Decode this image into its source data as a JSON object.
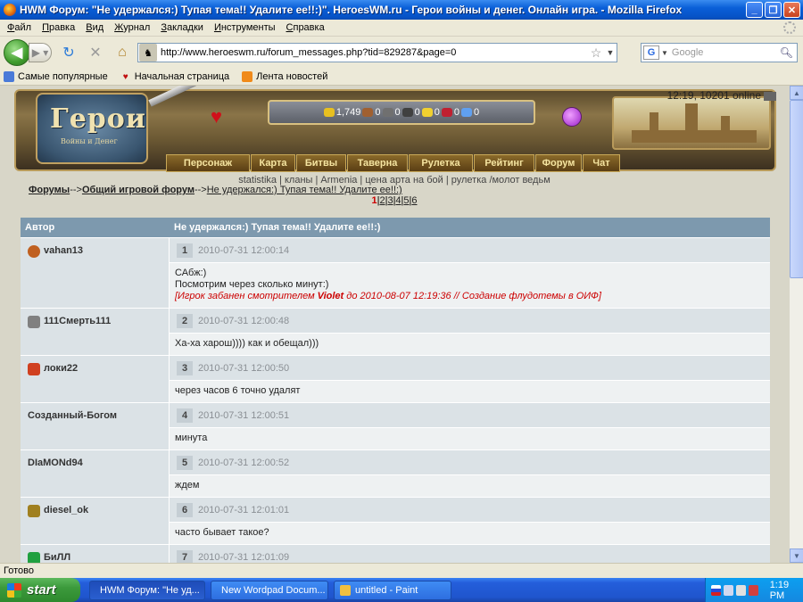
{
  "window": {
    "title": "HWM Форум: \"Не удержался:) Тупая тема!! Удалите ее!!:)\". HeroesWM.ru - Герои войны и денег. Онлайн игра. - Mozilla Firefox",
    "buttons": [
      "_",
      "❐",
      "✕"
    ]
  },
  "menubar": [
    "Файл",
    "Правка",
    "Вид",
    "Журнал",
    "Закладки",
    "Инструменты",
    "Справка"
  ],
  "nav": {
    "url": "http://www.heroeswm.ru/forum_messages.php?tid=829287&page=0",
    "search_placeholder": "Google"
  },
  "bookmarks": [
    "Самые популярные",
    "Начальная страница",
    "Лента новостей"
  ],
  "game": {
    "online": "12:19, 10201 online",
    "logo_big": "Герои",
    "logo_small": "Войны и Денег",
    "resources": [
      "1,749",
      "0",
      "0",
      "0",
      "0",
      "0",
      "0"
    ],
    "menu": [
      "Персонаж",
      "Карта",
      "Битвы",
      "Таверна",
      "Рулетка",
      "Рейтинг",
      "Форум",
      "Чат"
    ],
    "sublinks": "statistika | кланы | Armenia | цена арта на бой | рулетка /молот ведьм"
  },
  "breadcrumb": {
    "forums": "Форумы",
    "sep1": "-->",
    "general": "Общий игровой форум",
    "sep2": "-->",
    "topic": "Не удержался:) Тупая тема!! Удалите ее!!:)"
  },
  "pages": {
    "current": "1",
    "others": [
      "2",
      "3",
      "4",
      "5",
      "6"
    ]
  },
  "table": {
    "col_author": "Автор",
    "col_topic": "Не удержался:) Тупая тема!! Удалите ее!!:)",
    "posts": [
      {
        "author": "vahan13",
        "num": "1",
        "date": "2010-07-31 12:00:14",
        "lines": [
          "САбж:)",
          "Посмотрим через сколько минут:)"
        ],
        "ban": {
          "pre": "[Игрок забанен смотрителем ",
          "name": "Violet",
          "post": " до 2010-08-07 12:19:36 // Создание флудотемы в ОИФ]"
        }
      },
      {
        "author": "111Смерть111",
        "num": "2",
        "date": "2010-07-31 12:00:48",
        "lines": [
          "Ха-ха харош)))) как и обещал)))"
        ]
      },
      {
        "author": "локи22",
        "num": "3",
        "date": "2010-07-31 12:00:50",
        "lines": [
          "через часов 6 точно удалят"
        ]
      },
      {
        "author": "Созданный-Богом",
        "num": "4",
        "date": "2010-07-31 12:00:51",
        "lines": [
          "минута"
        ]
      },
      {
        "author": "DIaMONd94",
        "num": "5",
        "date": "2010-07-31 12:00:52",
        "lines": [
          "ждем"
        ]
      },
      {
        "author": "diesel_ok",
        "num": "6",
        "date": "2010-07-31 12:01:01",
        "lines": [
          "часто бывает такое?"
        ]
      },
      {
        "author": "БиЛЛ",
        "num": "7",
        "date": "2010-07-31 12:01:09",
        "lines": [
          ""
        ]
      }
    ]
  },
  "status": "Готово",
  "taskbar": {
    "start": "start",
    "tasks": [
      "HWM Форум: \"Не уд...",
      "New Wordpad Docum...",
      "untitled - Paint"
    ],
    "time": "1:19 PM"
  }
}
